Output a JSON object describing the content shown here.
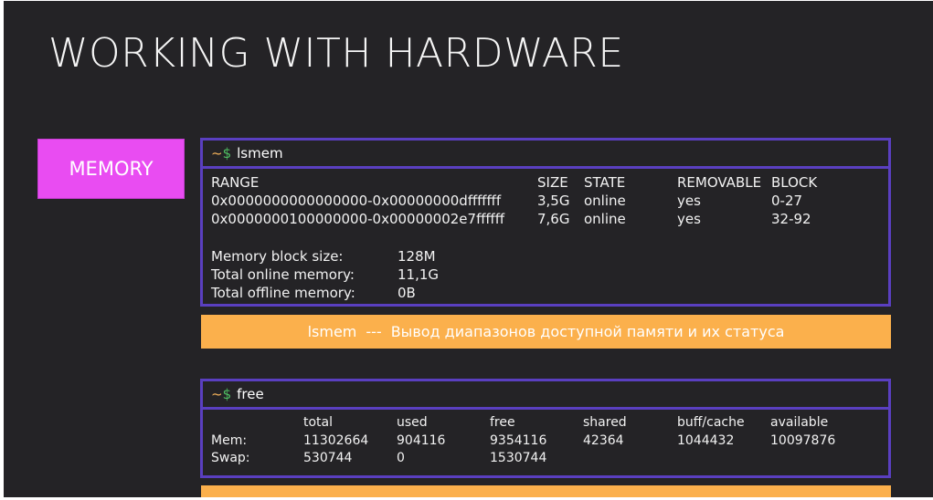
{
  "slide": {
    "title": "WORKING WITH HARDWARE",
    "section_badge": "MEMORY"
  },
  "lsmem": {
    "prompt_tilde": "~",
    "prompt_dollar": "$",
    "command": "lsmem",
    "headers": [
      "RANGE",
      "SIZE",
      "STATE",
      "REMOVABLE",
      "BLOCK"
    ],
    "rows": [
      [
        "0x0000000000000000-0x00000000dfffffff",
        "3,5G",
        "online",
        "yes",
        "0-27"
      ],
      [
        "0x0000000100000000-0x00000002e7ffffff",
        "7,6G",
        "online",
        "yes",
        "32-92"
      ]
    ],
    "summary": [
      {
        "label": "Memory block size:",
        "value": "128M"
      },
      {
        "label": "Total online memory:",
        "value": "11,1G"
      },
      {
        "label": "Total offline memory:",
        "value": "0B"
      }
    ],
    "note": {
      "command": "lsmem",
      "dashes": "---",
      "text": "Вывод диапазонов доступной памяти и их статуса"
    }
  },
  "free": {
    "prompt_tilde": "~",
    "prompt_dollar": "$",
    "command": "free",
    "headers": [
      "total",
      "used",
      "free",
      "shared",
      "buff/cache",
      "available"
    ],
    "rows": [
      {
        "label": "Mem:",
        "values": [
          "11302664",
          "904116",
          "9354116",
          "42364",
          "1044432",
          "10097876"
        ]
      },
      {
        "label": "Swap:",
        "values": [
          "530744",
          "0",
          "1530744",
          "",
          "",
          ""
        ]
      }
    ]
  },
  "colors": {
    "background": "#242326",
    "badge": "#e94cf2",
    "terminal_border": "#5a3fc0",
    "note_bar": "#fbb04c",
    "prompt_tilde": "#f2b15a",
    "prompt_dollar": "#4fbf62"
  }
}
